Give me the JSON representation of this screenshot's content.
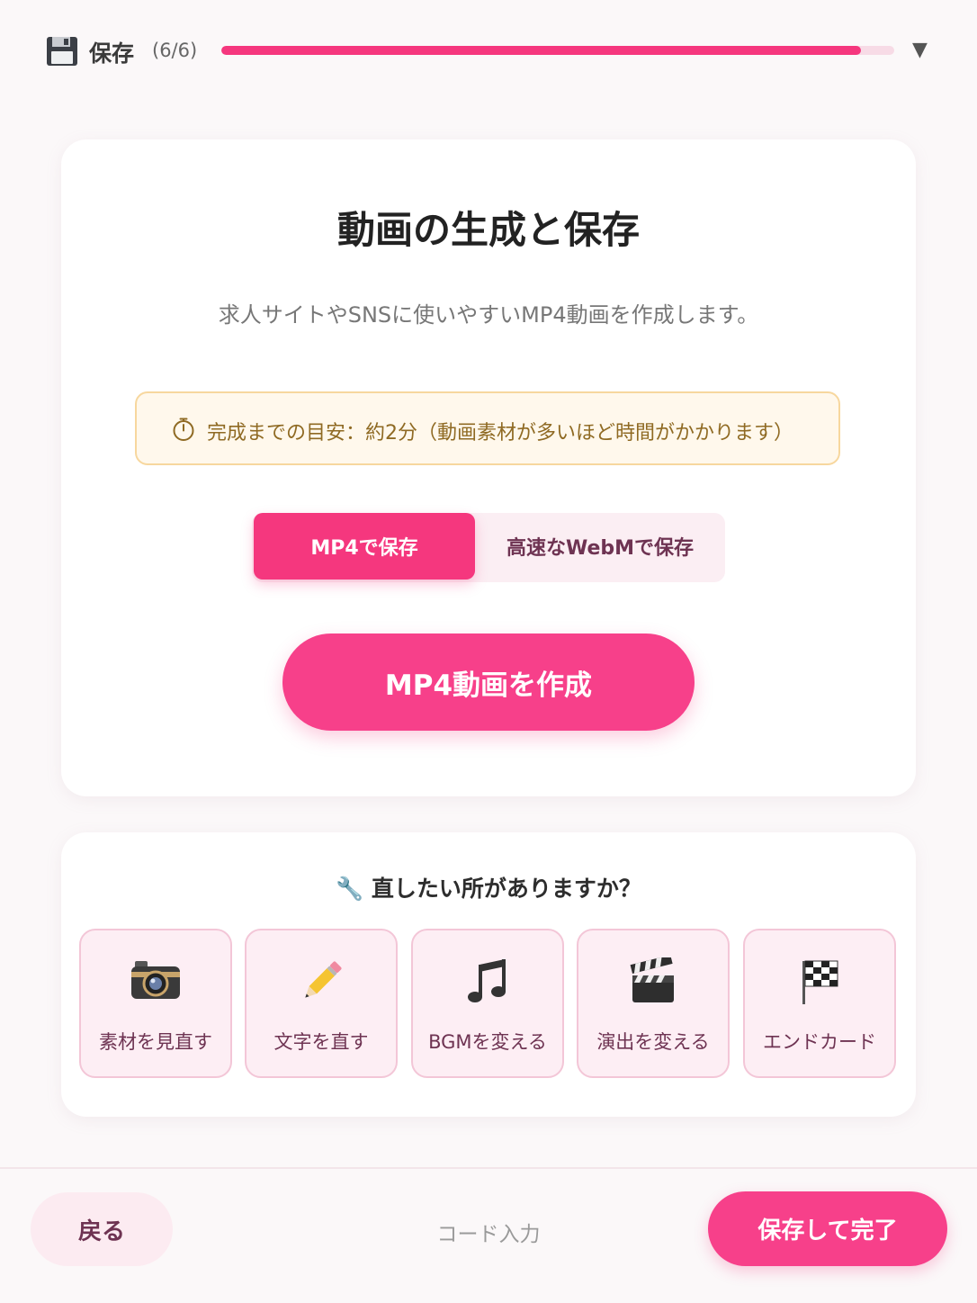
{
  "header": {
    "step_title": "保存",
    "step_count": "(6/6)",
    "progress": 0.95,
    "toggle_arrow": "▼",
    "icon": "floppy-disk-icon"
  },
  "main": {
    "title": "動画の生成と保存",
    "subtitle": "求人サイトやSNSに使いやすいMP4動画を作成します。",
    "notice": {
      "icon": "stopwatch-icon",
      "text": "完成までの目安：約2分（動画素材が多いほど時間がかかります）"
    },
    "format_toggle": {
      "options": [
        "MP4で保存",
        "高速なWebMで保存"
      ],
      "selected": "MP4で保存"
    },
    "create_button": "MP4動画を作成"
  },
  "fix_section": {
    "title": "🔧 直したい所がありますか？",
    "items": [
      {
        "icon": "camera-icon",
        "label": "素材を見直す"
      },
      {
        "icon": "pencil-icon",
        "label": "文字を直す"
      },
      {
        "icon": "music-note-icon",
        "label": "BGMを変える"
      },
      {
        "icon": "clapperboard-icon",
        "label": "演出を変える"
      },
      {
        "icon": "checkered-flag-icon",
        "label": "エンドカード"
      }
    ]
  },
  "footer": {
    "back": "戻る",
    "code": "コード入力",
    "done": "保存して完了"
  },
  "colors": {
    "accent": "#f5377e",
    "accent_light": "#fdeef4",
    "notice_bg": "#fff8ec",
    "notice_text": "#8f6a23"
  }
}
